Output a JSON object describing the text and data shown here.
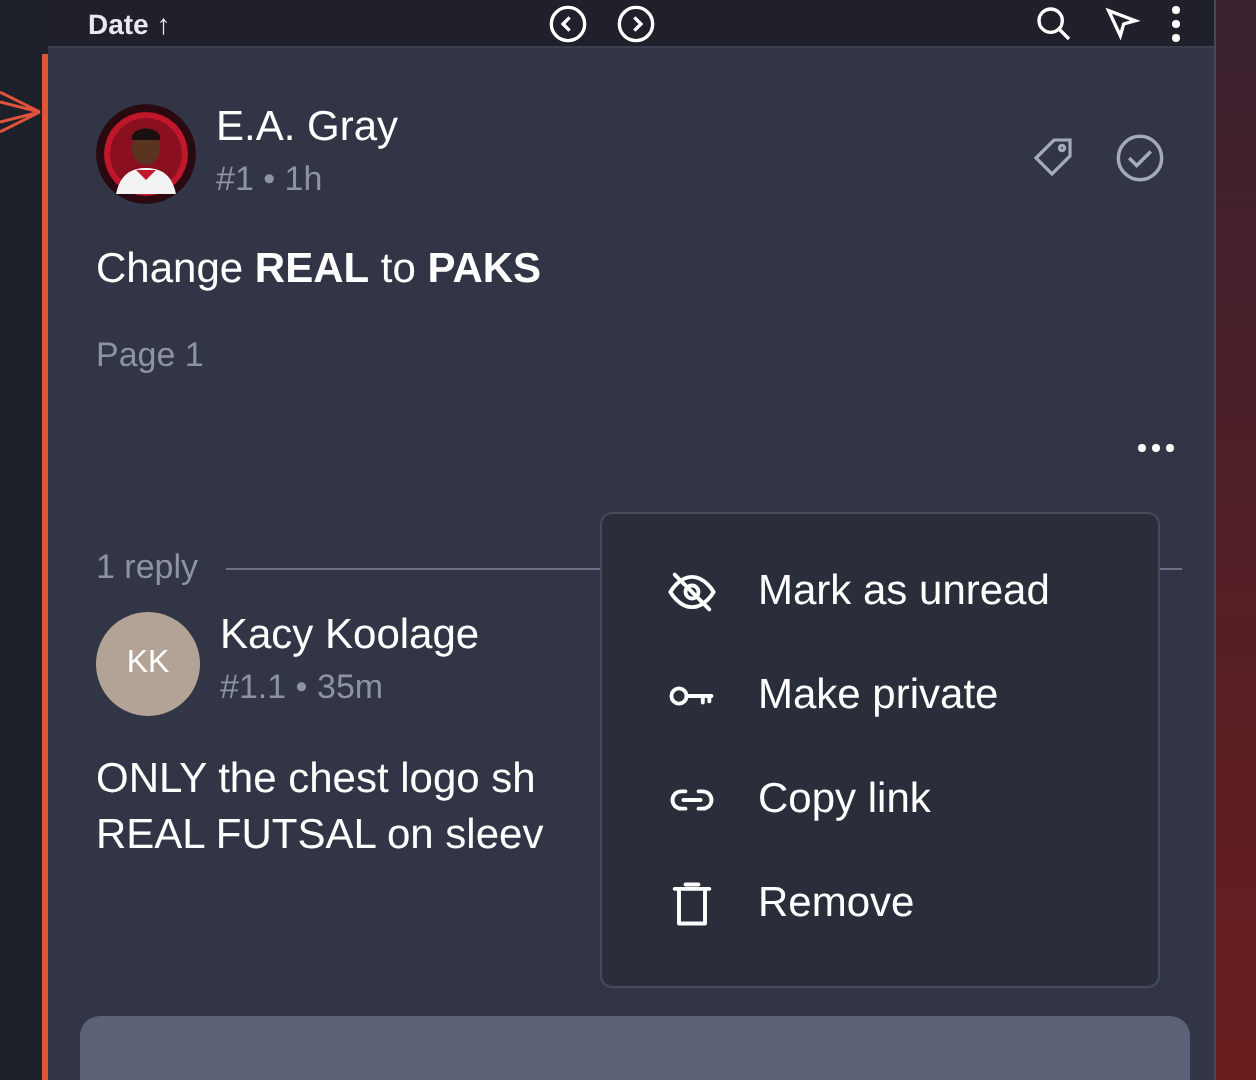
{
  "toolbar": {
    "sort_label": "Date ↑"
  },
  "comment": {
    "author": "E.A. Gray",
    "meta": "#1 • 1h",
    "body": "Change **REAL** to **PAKS**",
    "page": "Page 1",
    "resolved": false
  },
  "replies_label": "1 reply",
  "reply": {
    "initials": "KK",
    "author": "Kacy Koolage",
    "meta": "#1.1 • 35m",
    "body_lines": [
      "ONLY the chest logo sh",
      "REAL FUTSAL on sleev"
    ]
  },
  "menu": {
    "items": [
      {
        "kind": "unread",
        "label": "Mark as unread"
      },
      {
        "kind": "private",
        "label": "Make private"
      },
      {
        "kind": "link",
        "label": "Copy link"
      },
      {
        "kind": "remove",
        "label": "Remove"
      }
    ]
  }
}
